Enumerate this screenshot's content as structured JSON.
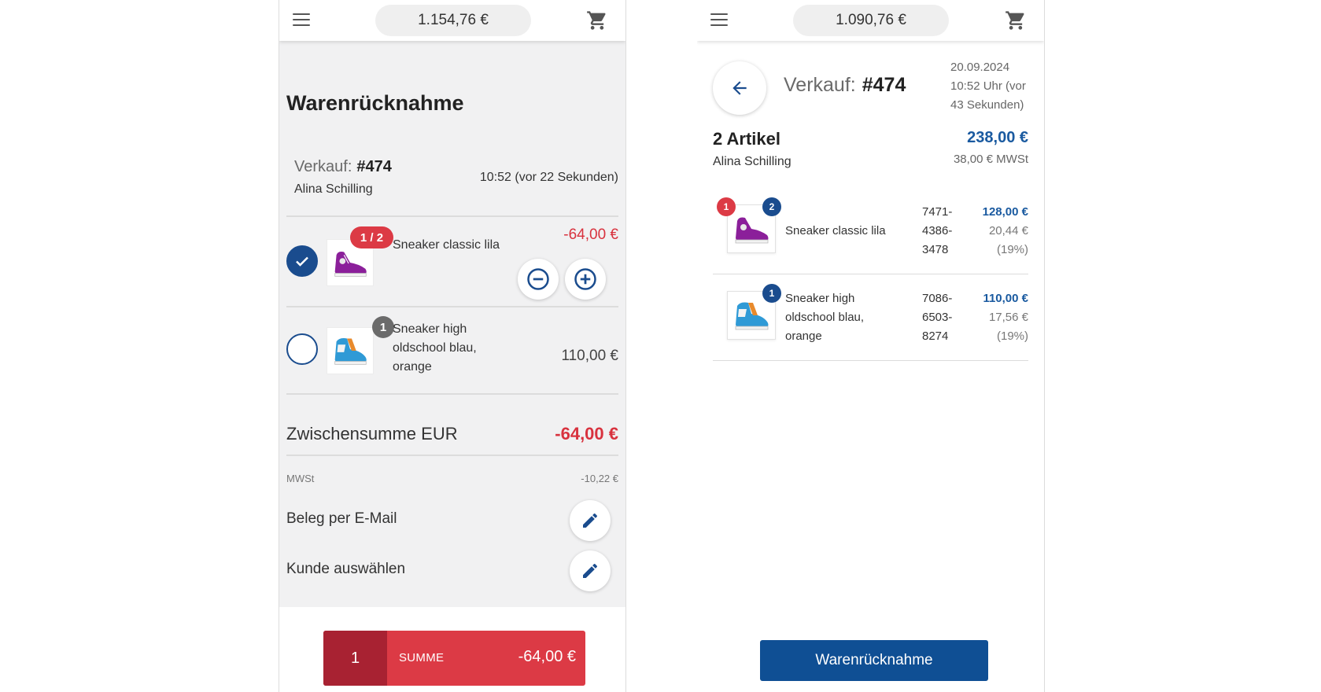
{
  "left": {
    "header": {
      "balance": "1.154,76 €"
    },
    "title": "Warenrücknahme",
    "sale": {
      "label": "Verkauf:",
      "number": "#474",
      "customer": "Alina Schilling",
      "time": "10:52 (vor 22 Sekunden)"
    },
    "items": [
      {
        "name": "Sneaker classic lila",
        "badge": "1 / 2",
        "price": "-64,00 €",
        "selected": true
      },
      {
        "name_lines": [
          "Sneaker high",
          "oldschool blau,",
          "orange"
        ],
        "badge": "1",
        "price": "110,00 €",
        "selected": false
      }
    ],
    "subtotal": {
      "label": "Zwischensumme EUR",
      "value": "-64,00 €"
    },
    "mwst": {
      "label": "MWSt",
      "value": "-10,22 €"
    },
    "options": {
      "email": "Beleg per E-Mail",
      "customer": "Kunde auswählen"
    },
    "footer": {
      "count": "1",
      "label": "SUMME",
      "amount": "-64,00 €"
    }
  },
  "right": {
    "header": {
      "balance": "1.090,76 €"
    },
    "sale": {
      "label": "Verkauf:",
      "number": "#474",
      "date_lines": [
        "20.09.2024",
        "10:52 Uhr (vor",
        "43 Sekunden)"
      ]
    },
    "summary": {
      "count": "2 Artikel",
      "customer": "Alina Schilling",
      "total": "238,00 €",
      "mwst": "38,00 € MWSt"
    },
    "items": [
      {
        "name": "Sneaker classic lila",
        "badge_returned": "1",
        "badge_qty": "2",
        "sku_lines": [
          "7471-",
          "4386-",
          "3478"
        ],
        "price": "128,00 €",
        "tax": "20,44 €",
        "tax_rate": "(19%)"
      },
      {
        "name_lines": [
          "Sneaker high",
          "oldschool blau,",
          "orange"
        ],
        "badge_qty": "1",
        "sku_lines": [
          "7086-",
          "6503-",
          "8274"
        ],
        "price": "110,00 €",
        "tax": "17,56 €",
        "tax_rate": "(19%)"
      }
    ],
    "action": "Warenrücknahme"
  },
  "icons": [
    "menu-icon",
    "cart-icon",
    "check-icon",
    "minus-circle-icon",
    "plus-circle-icon",
    "pencil-icon",
    "arrow-left-icon",
    "purple-sneaker-icon",
    "blue-sneaker-icon"
  ],
  "colors": {
    "primary_blue": "#1a4c8e",
    "accent_red": "#dc3a45",
    "dark_red": "#a82232",
    "price_blue": "#1a5aa0",
    "badge_gray": "#6b6b6b",
    "button_blue": "#0f4f94"
  }
}
